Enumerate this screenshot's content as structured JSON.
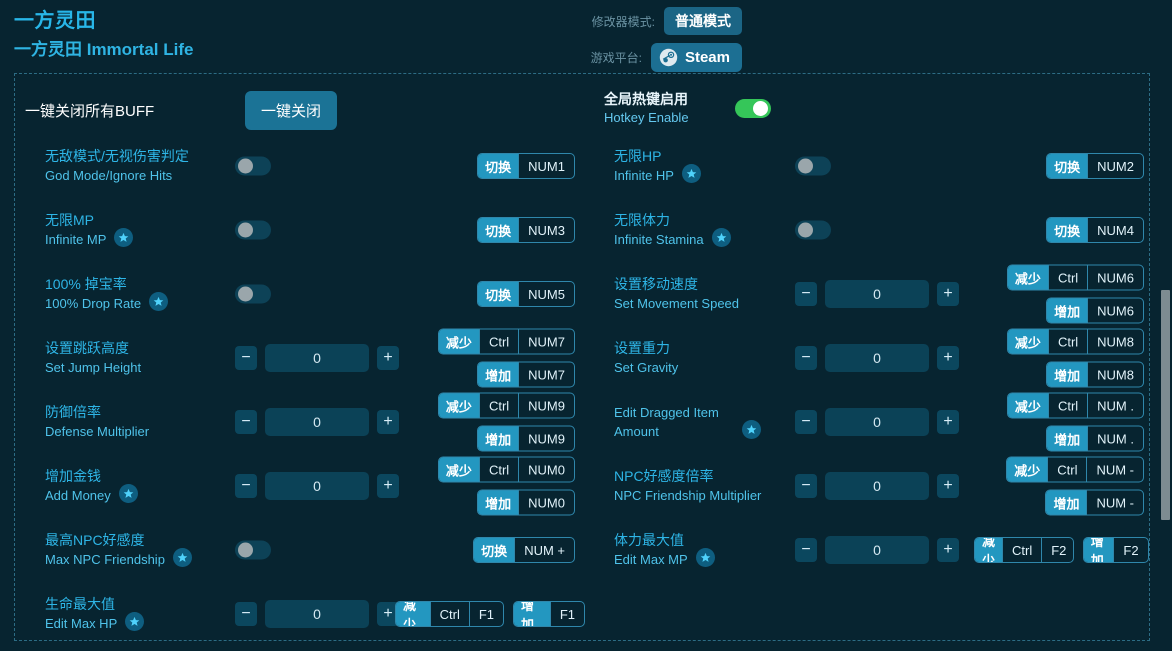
{
  "header": {
    "title_cn": "一方灵田",
    "title_full": "一方灵田 Immortal Life",
    "mode_label": "修改器模式:",
    "mode_value": "普通模式",
    "platform_label": "游戏平台:",
    "platform_value": "Steam",
    "steam_icon": "steam-icon"
  },
  "all_buff": {
    "label": "一键关闭所有BUFF",
    "button": "一键关闭"
  },
  "hotkey_enable": {
    "cn": "全局热键启用",
    "en": "Hotkey Enable",
    "state": "on"
  },
  "ui": {
    "toggle_action": "切换",
    "decrease_action": "减少",
    "increase_action": "增加",
    "ctrl_key": "Ctrl",
    "minus_glyph": "−",
    "plus_glyph": "+",
    "star_icon": "star-badge-icon"
  },
  "colors": {
    "background": "#072430",
    "accent": "#2eb5e6",
    "chip_fill": "#2397c0",
    "switch_on": "#35c659",
    "input_bg": "#0b4257"
  },
  "left_rows": [
    {
      "cn": "无敌模式/无视伤害判定",
      "en": "God Mode/Ignore Hits",
      "star": false,
      "control": "toggle",
      "toggle": "off",
      "hotkeys": [
        {
          "action": "切换",
          "keys": [
            "NUM1"
          ]
        }
      ]
    },
    {
      "cn": "无限MP",
      "en": "Infinite MP",
      "star": true,
      "control": "toggle",
      "toggle": "off",
      "hotkeys": [
        {
          "action": "切换",
          "keys": [
            "NUM3"
          ]
        }
      ]
    },
    {
      "cn": "100% 掉宝率",
      "en": "100% Drop Rate",
      "star": true,
      "control": "toggle",
      "toggle": "off",
      "hotkeys": [
        {
          "action": "切换",
          "keys": [
            "NUM5"
          ]
        }
      ]
    },
    {
      "cn": "设置跳跃高度",
      "en": "Set Jump Height",
      "star": false,
      "control": "stepper",
      "value": "0",
      "hotkeys": [
        {
          "action": "减少",
          "keys": [
            "Ctrl",
            "NUM7"
          ]
        },
        {
          "action": "增加",
          "keys": [
            "NUM7"
          ]
        }
      ]
    },
    {
      "cn": "防御倍率",
      "en": "Defense Multiplier",
      "star": false,
      "control": "stepper",
      "value": "0",
      "hotkeys": [
        {
          "action": "减少",
          "keys": [
            "Ctrl",
            "NUM9"
          ]
        },
        {
          "action": "增加",
          "keys": [
            "NUM9"
          ]
        }
      ]
    },
    {
      "cn": "增加金钱",
      "en": "Add Money",
      "star": true,
      "control": "stepper",
      "value": "0",
      "hotkeys": [
        {
          "action": "减少",
          "keys": [
            "Ctrl",
            "NUM0"
          ]
        },
        {
          "action": "增加",
          "keys": [
            "NUM0"
          ]
        }
      ]
    },
    {
      "cn": "最高NPC好感度",
      "en": "Max NPC Friendship",
      "star": true,
      "control": "toggle",
      "toggle": "off",
      "hotkeys": [
        {
          "action": "切换",
          "keys": [
            "NUM +"
          ]
        }
      ]
    },
    {
      "cn": "生命最大值",
      "en": "Edit Max HP",
      "star": true,
      "control": "stepper",
      "value": "0",
      "inline_hotkeys": true,
      "hotkeys": [
        {
          "action": "减少",
          "keys": [
            "Ctrl",
            "F1"
          ]
        },
        {
          "action": "增加",
          "keys": [
            "F1"
          ]
        }
      ]
    }
  ],
  "right_rows": [
    {
      "cn": "无限HP",
      "en": "Infinite HP",
      "star": true,
      "control": "toggle",
      "toggle": "off",
      "hotkeys": [
        {
          "action": "切换",
          "keys": [
            "NUM2"
          ]
        }
      ]
    },
    {
      "cn": "无限体力",
      "en": "Infinite Stamina",
      "star": true,
      "control": "toggle",
      "toggle": "off",
      "hotkeys": [
        {
          "action": "切换",
          "keys": [
            "NUM4"
          ]
        }
      ]
    },
    {
      "cn": "设置移动速度",
      "en": "Set Movement Speed",
      "star": false,
      "control": "stepper",
      "value": "0",
      "hotkeys": [
        {
          "action": "减少",
          "keys": [
            "Ctrl",
            "NUM6"
          ]
        },
        {
          "action": "增加",
          "keys": [
            "NUM6"
          ]
        }
      ]
    },
    {
      "cn": "设置重力",
      "en": "Set Gravity",
      "star": false,
      "control": "stepper",
      "value": "0",
      "hotkeys": [
        {
          "action": "减少",
          "keys": [
            "Ctrl",
            "NUM8"
          ]
        },
        {
          "action": "增加",
          "keys": [
            "NUM8"
          ]
        }
      ]
    },
    {
      "cn": "",
      "en": "Edit Dragged Item Amount",
      "star": true,
      "wrap": true,
      "control": "stepper",
      "value": "0",
      "hotkeys": [
        {
          "action": "减少",
          "keys": [
            "Ctrl",
            "NUM ."
          ]
        },
        {
          "action": "增加",
          "keys": [
            "NUM ."
          ]
        }
      ]
    },
    {
      "cn": "NPC好感度倍率",
      "en": "NPC Friendship Multiplier",
      "star": false,
      "control": "stepper",
      "value": "0",
      "hotkeys": [
        {
          "action": "减少",
          "keys": [
            "Ctrl",
            "NUM -"
          ]
        },
        {
          "action": "增加",
          "keys": [
            "NUM -"
          ]
        }
      ]
    },
    {
      "cn": "体力最大值",
      "en": "Edit Max MP",
      "star": true,
      "control": "stepper",
      "value": "0",
      "inline_hotkeys": true,
      "hotkeys": [
        {
          "action": "减少",
          "keys": [
            "Ctrl",
            "F2"
          ]
        },
        {
          "action": "增加",
          "keys": [
            "F2"
          ]
        }
      ]
    }
  ]
}
